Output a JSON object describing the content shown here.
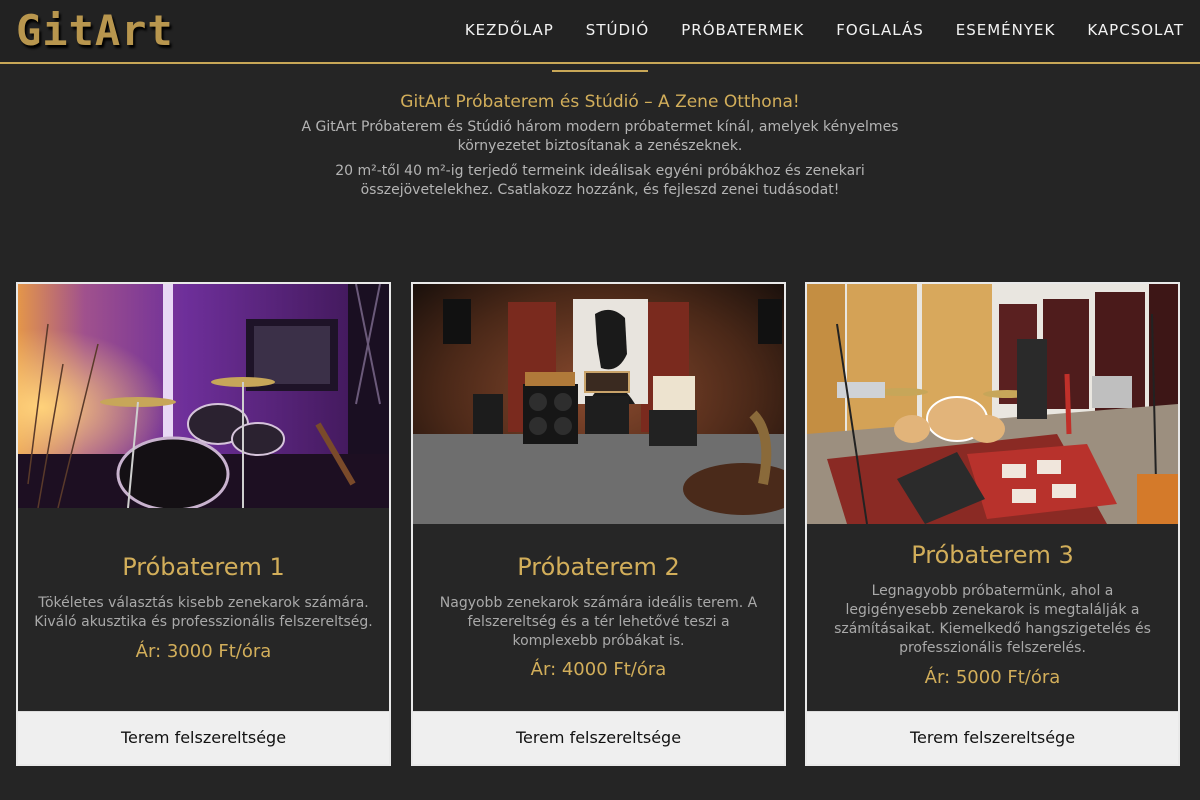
{
  "header": {
    "logo": "GitArt",
    "nav": [
      "KEZDŐLAP",
      "STÚDIÓ",
      "PRÓBATERMEK",
      "FOGLALÁS",
      "ESEMÉNYEK",
      "KAPCSOLAT"
    ]
  },
  "intro": {
    "title": "GitArt Próbaterem és Stúdió – A Zene Otthona!",
    "paragraphs": [
      "A GitArt Próbaterem és Stúdió három modern próbatermet kínál, amelyek kényelmes környezetet biztosítanak a zenészeknek.",
      "20 m²-től 40 m²-ig terjedő termeink ideálisak egyéni próbákhoz és zenekari összejövetelekhez. Csatlakozz hozzánk, és fejleszd zenei tudásodat!"
    ]
  },
  "rooms": [
    {
      "title": "Próbaterem 1",
      "description": "Tökéletes választás kisebb zenekarok számára. Kiváló akusztika és professzionális felszereltség.",
      "price": "Ár: 3000 Ft/óra",
      "button": "Terem felszereltsége"
    },
    {
      "title": "Próbaterem 2",
      "description": "Nagyobb zenekarok számára ideális terem. A felszereltség és a tér lehetővé teszi a komplexebb próbákat is.",
      "price": "Ár: 4000 Ft/óra",
      "button": "Terem felszereltsége"
    },
    {
      "title": "Próbaterem 3",
      "description": "Legnagyobb próbatermünk, ahol a legigényesebb zenekarok is megtalálják a számításaikat. Kiemelkedő hangszigetelés és professzionális felszerelés.",
      "price": "Ár: 5000 Ft/óra",
      "button": "Terem felszereltsége"
    }
  ],
  "colors": {
    "background": "#252525",
    "accent": "#c8a757",
    "button_bg": "#efefef"
  }
}
